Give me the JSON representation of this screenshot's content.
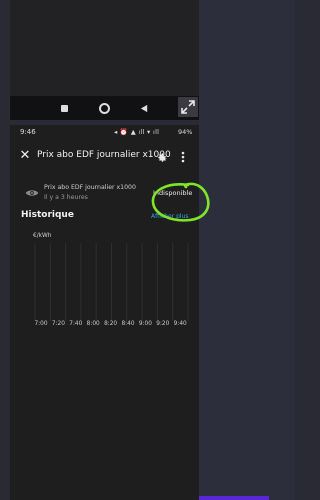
{
  "status_bar": {
    "time": "9:46",
    "icons_text": "◂ ⏰ ▲ ıll ▾ ıll",
    "battery": "94%"
  },
  "dialog": {
    "title": "Prix abo EDF journalier x1000"
  },
  "entity": {
    "name": "Prix abo EDF journalier x1000",
    "last_changed": "Il y a 3 heures",
    "state": "Indisponible",
    "more_info_link": "Afficher plus"
  },
  "history": {
    "heading": "Historique",
    "unit": "€/kWh"
  },
  "chart_data": {
    "type": "line",
    "ylabel": "€/kWh",
    "x_ticks": [
      "7:00",
      "7:20",
      "7:40",
      "8:00",
      "8:20",
      "8:40",
      "9:00",
      "9:20",
      "9:40"
    ],
    "series": [],
    "grid": true
  },
  "colors": {
    "background": "#1e1e1e",
    "link": "#39a6d8",
    "annotation": "#7fe52a",
    "accent_bar": "#5a27d8"
  }
}
